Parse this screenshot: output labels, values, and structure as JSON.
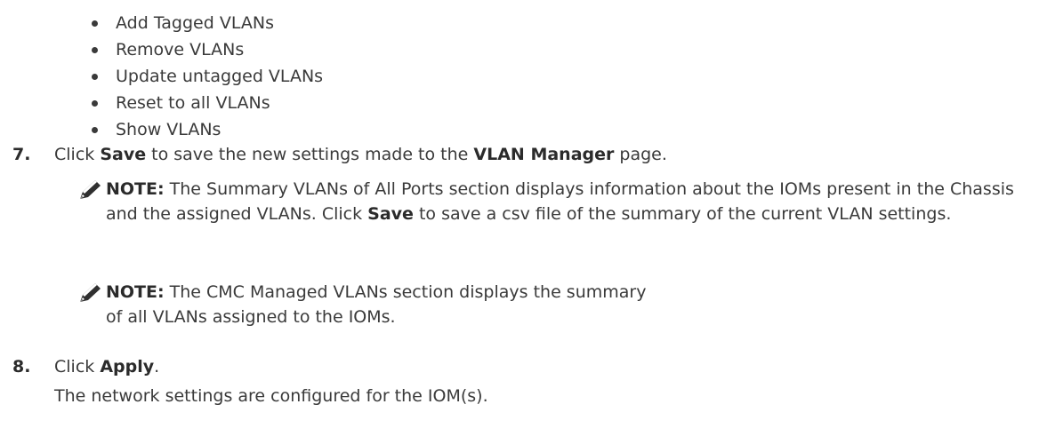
{
  "bullets": [
    "Add Tagged VLANs",
    "Remove VLANs",
    "Update untagged VLANs",
    "Reset to all VLANs",
    "Show VLANs"
  ],
  "step7": {
    "number": "7.",
    "prefix": "Click ",
    "save": "Save",
    "middle": " to save the new settings made to the ",
    "page_name": "VLAN Manager",
    "suffix": " page."
  },
  "note1": {
    "label": "NOTE:",
    "part1": " The Summary VLANs of All Ports section displays information about the IOMs present in the Chassis and the assigned VLANs. Click ",
    "save": "Save",
    "part2": " to save a csv file of the summary of the current VLAN settings."
  },
  "note2": {
    "label": "NOTE:",
    "text": " The CMC Managed VLANs section displays the summary of all VLANs assigned to the IOMs."
  },
  "step8": {
    "number": "8.",
    "prefix": "Click ",
    "apply": "Apply",
    "suffix": "."
  },
  "result": "The network settings are configured for the IOM(s).",
  "icons": {
    "note": "pencil-note-icon"
  }
}
